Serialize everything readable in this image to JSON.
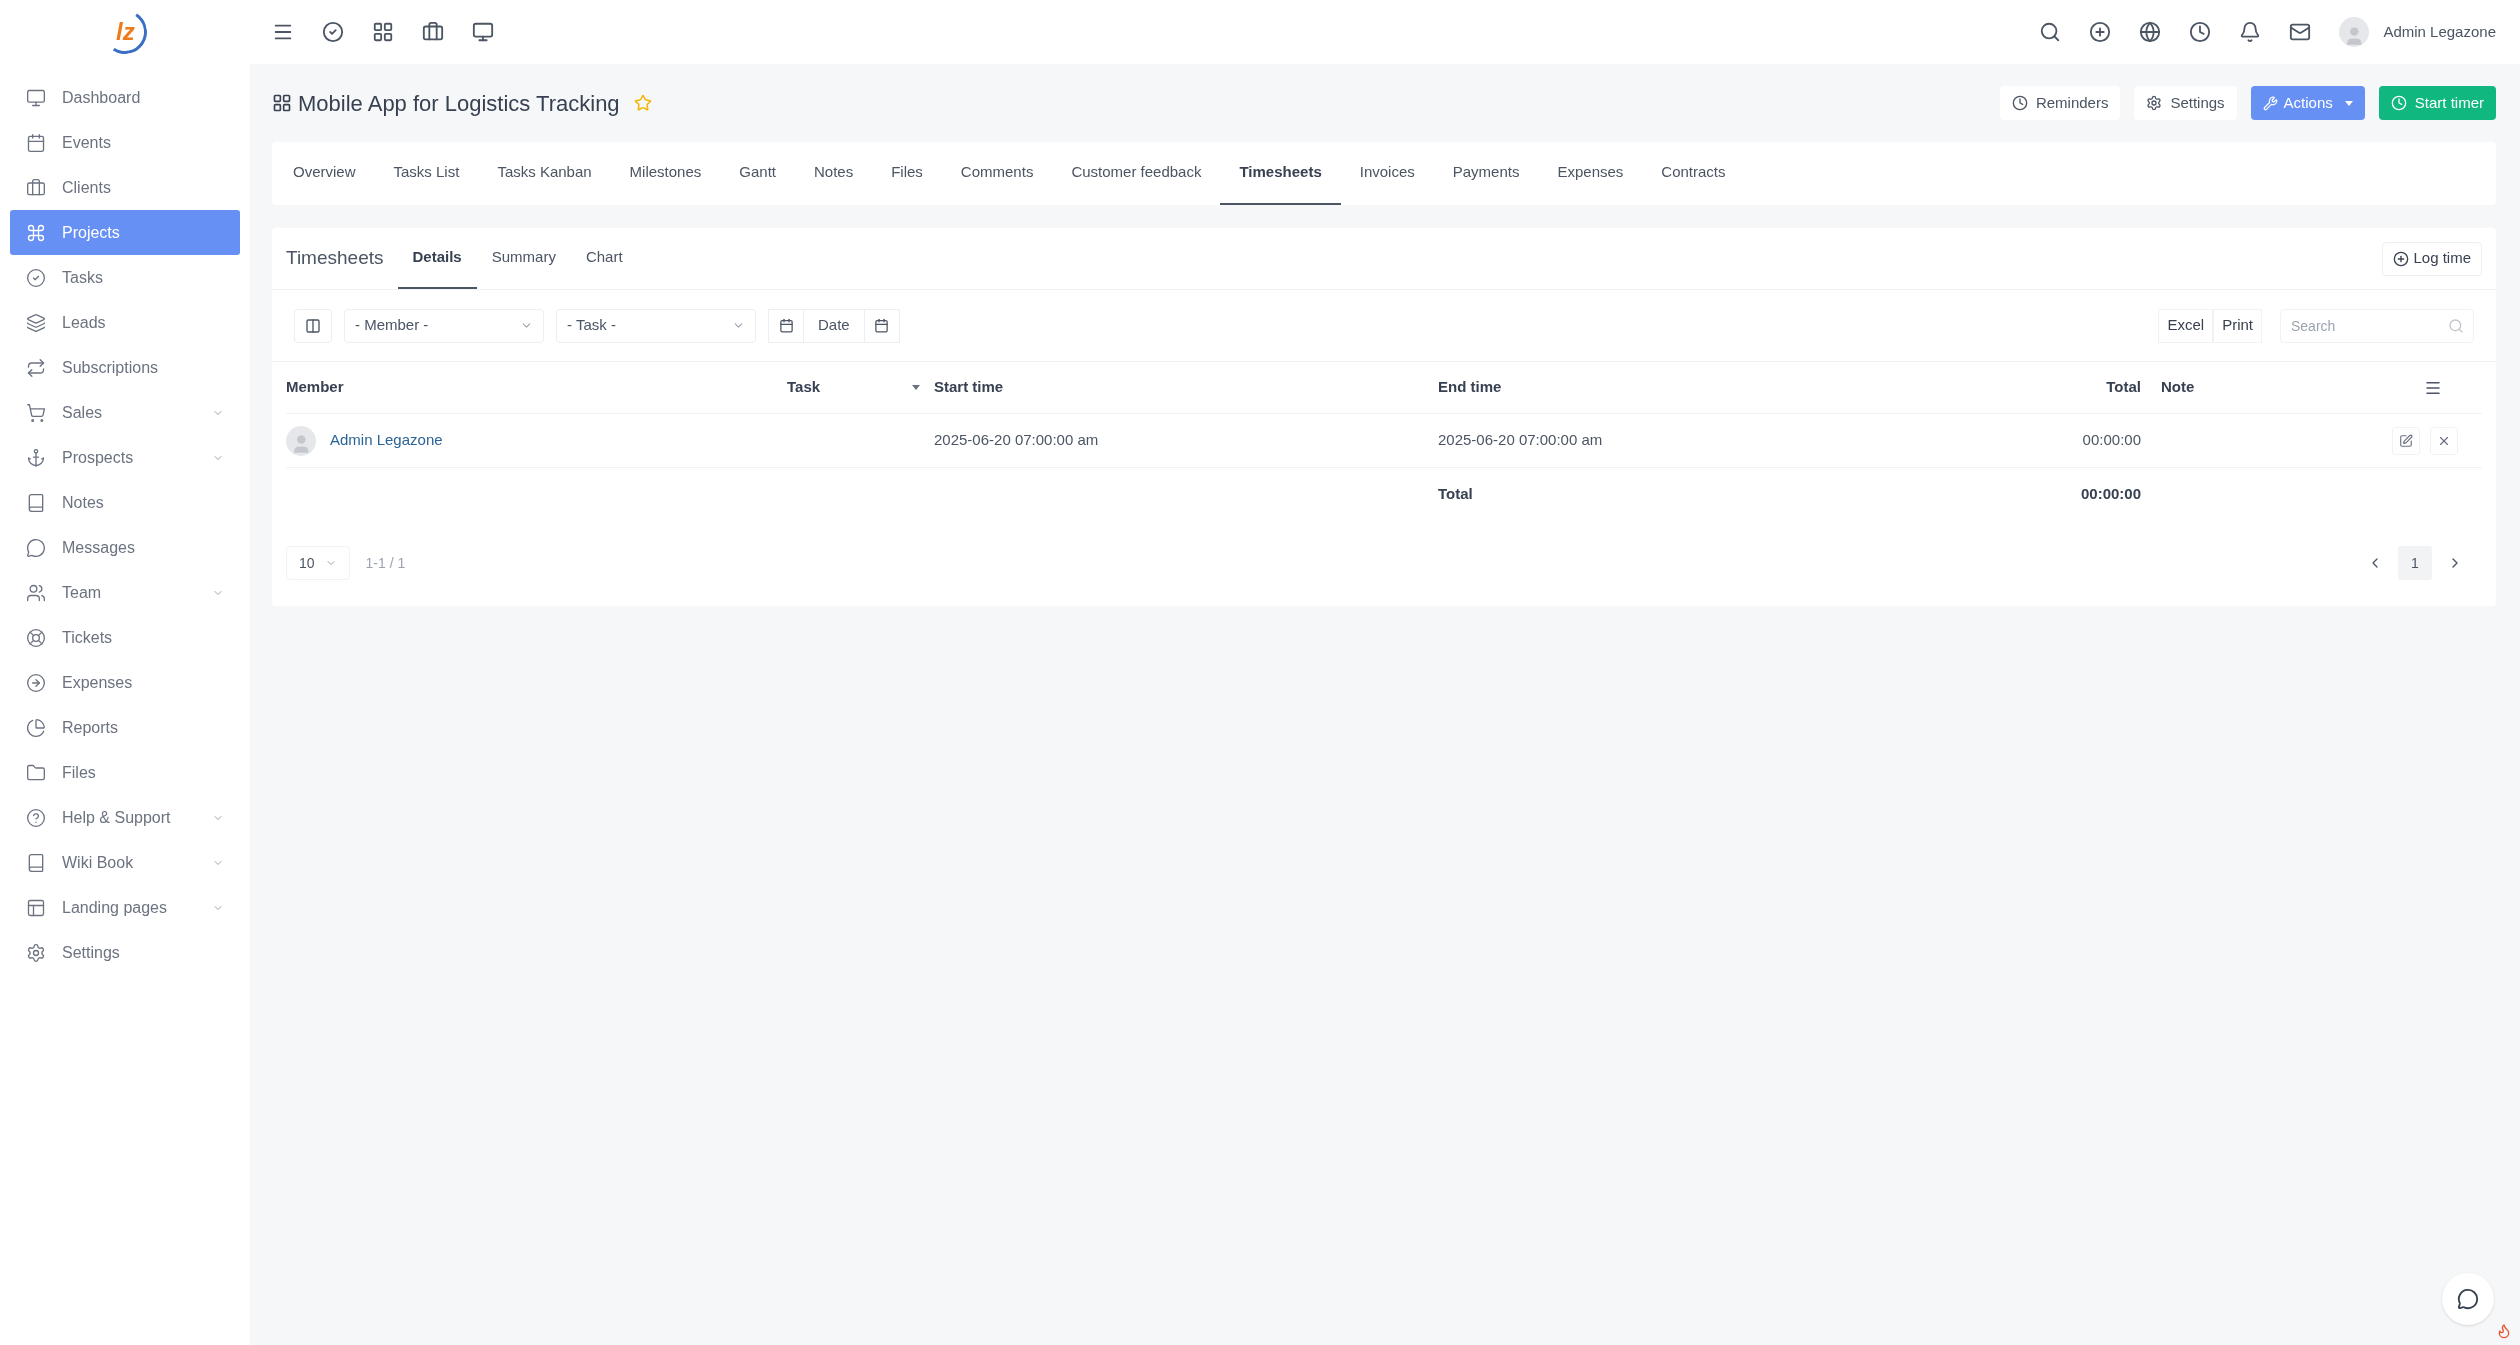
{
  "logo": {
    "text": "lz"
  },
  "topbar": {
    "user": "Admin Legazone"
  },
  "sidebar": {
    "items": [
      {
        "label": "Dashboard",
        "selected": false,
        "has_submenu": false
      },
      {
        "label": "Events",
        "selected": false,
        "has_submenu": false
      },
      {
        "label": "Clients",
        "selected": false,
        "has_submenu": false
      },
      {
        "label": "Projects",
        "selected": true,
        "has_submenu": false
      },
      {
        "label": "Tasks",
        "selected": false,
        "has_submenu": false
      },
      {
        "label": "Leads",
        "selected": false,
        "has_submenu": false
      },
      {
        "label": "Subscriptions",
        "selected": false,
        "has_submenu": false
      },
      {
        "label": "Sales",
        "selected": false,
        "has_submenu": true
      },
      {
        "label": "Prospects",
        "selected": false,
        "has_submenu": true
      },
      {
        "label": "Notes",
        "selected": false,
        "has_submenu": false
      },
      {
        "label": "Messages",
        "selected": false,
        "has_submenu": false
      },
      {
        "label": "Team",
        "selected": false,
        "has_submenu": true
      },
      {
        "label": "Tickets",
        "selected": false,
        "has_submenu": false
      },
      {
        "label": "Expenses",
        "selected": false,
        "has_submenu": false
      },
      {
        "label": "Reports",
        "selected": false,
        "has_submenu": false
      },
      {
        "label": "Files",
        "selected": false,
        "has_submenu": false
      },
      {
        "label": "Help & Support",
        "selected": false,
        "has_submenu": true
      },
      {
        "label": "Wiki Book",
        "selected": false,
        "has_submenu": true
      },
      {
        "label": "Landing pages",
        "selected": false,
        "has_submenu": true
      },
      {
        "label": "Settings",
        "selected": false,
        "has_submenu": false
      }
    ]
  },
  "page": {
    "title": "Mobile App for Logistics Tracking",
    "reminders": "Reminders",
    "settings": "Settings",
    "actions": "Actions",
    "start_timer": "Start timer"
  },
  "tabs": [
    {
      "label": "Overview",
      "selected": false
    },
    {
      "label": "Tasks List",
      "selected": false
    },
    {
      "label": "Tasks Kanban",
      "selected": false
    },
    {
      "label": "Milestones",
      "selected": false
    },
    {
      "label": "Gantt",
      "selected": false
    },
    {
      "label": "Notes",
      "selected": false
    },
    {
      "label": "Files",
      "selected": false
    },
    {
      "label": "Comments",
      "selected": false
    },
    {
      "label": "Customer feedback",
      "selected": false
    },
    {
      "label": "Timesheets",
      "selected": true
    },
    {
      "label": "Invoices",
      "selected": false
    },
    {
      "label": "Payments",
      "selected": false
    },
    {
      "label": "Expenses",
      "selected": false
    },
    {
      "label": "Contracts",
      "selected": false
    }
  ],
  "timesheets": {
    "title": "Timesheets",
    "subtabs": [
      {
        "label": "Details",
        "selected": true
      },
      {
        "label": "Summary",
        "selected": false
      },
      {
        "label": "Chart",
        "selected": false
      }
    ],
    "log_time": "Log time",
    "filters": {
      "member": "- Member -",
      "task": "- Task -",
      "date": "Date"
    },
    "export": [
      "Excel",
      "Print"
    ],
    "search": {
      "placeholder": "Search"
    },
    "columns": [
      {
        "label": "Member",
        "sorted": false
      },
      {
        "label": "Task",
        "sorted": true
      },
      {
        "label": "Start time",
        "sorted": false
      },
      {
        "label": "End time",
        "sorted": false
      },
      {
        "label": "Total",
        "sorted": false
      },
      {
        "label": "Note",
        "sorted": false
      }
    ],
    "rows": [
      {
        "member": "Admin Legazone",
        "start_time": "2025-06-20 07:00:00 am",
        "end_time": "2025-06-20 07:00:00 am",
        "total": "00:00:00"
      }
    ],
    "footer": {
      "label": "Total",
      "total": "00:00:00"
    },
    "pagination": {
      "page_size": "10",
      "range": "1-1 / 1",
      "pages": [
        {
          "label": "1",
          "selected": true
        }
      ]
    }
  }
}
